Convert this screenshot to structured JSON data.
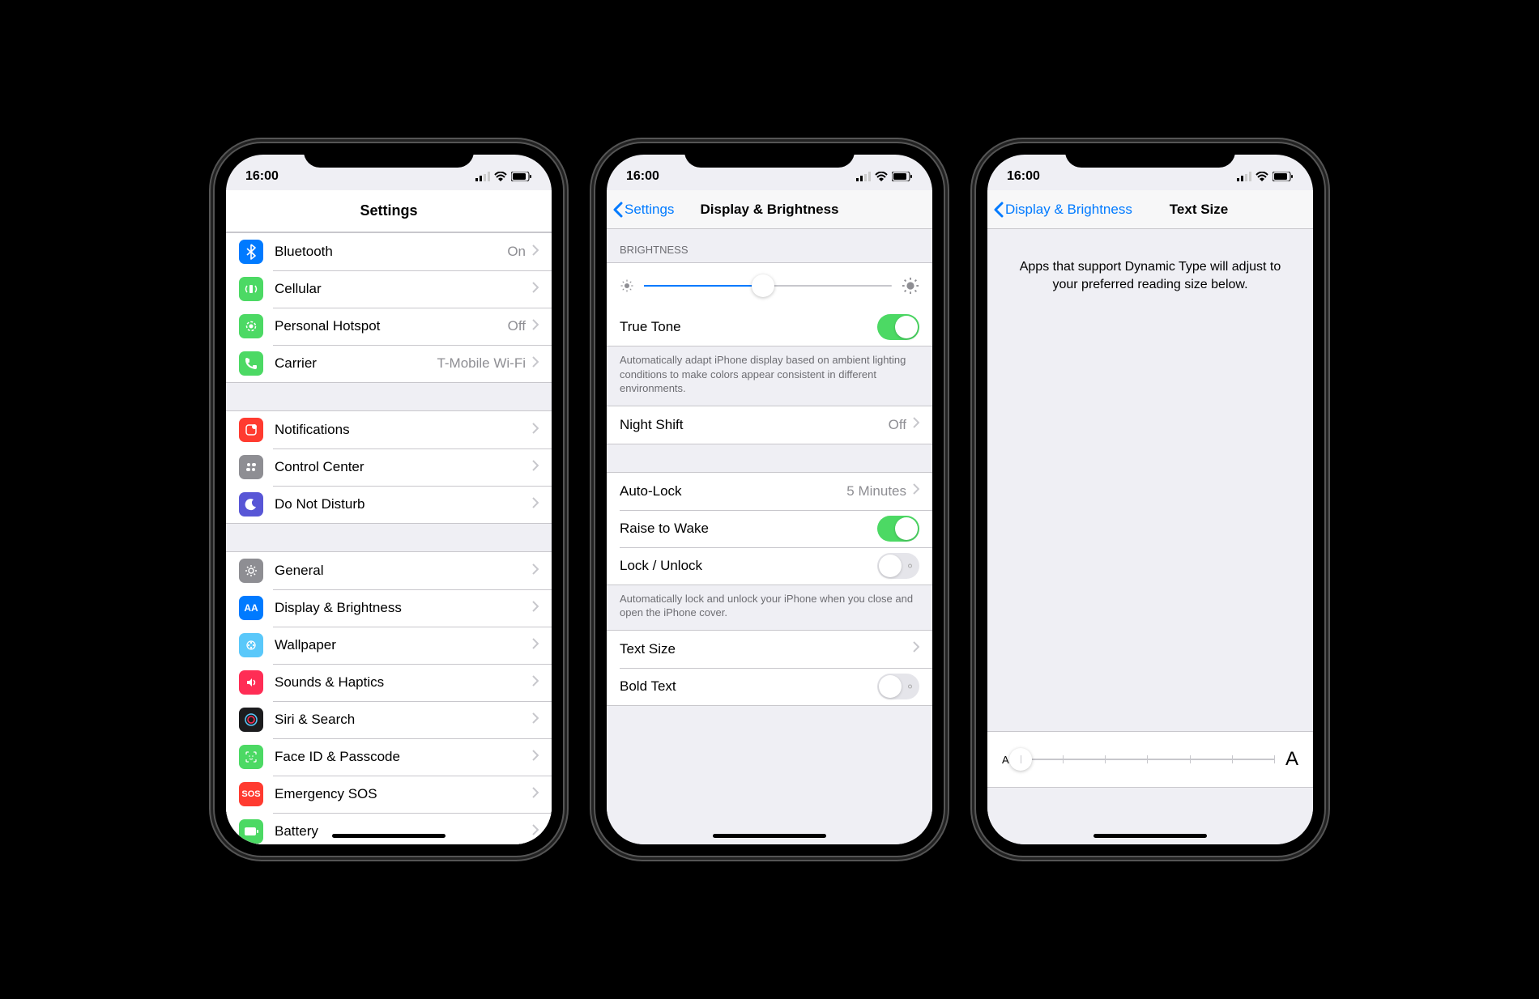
{
  "status": {
    "time": "16:00"
  },
  "screen1": {
    "title": "Settings",
    "groups": [
      {
        "rows": [
          {
            "icon": "bluetooth",
            "bg": "#007aff",
            "label": "Bluetooth",
            "value": "On",
            "chevron": true
          },
          {
            "icon": "cellular",
            "bg": "#4cd964",
            "label": "Cellular",
            "value": "",
            "chevron": true
          },
          {
            "icon": "hotspot",
            "bg": "#4cd964",
            "label": "Personal Hotspot",
            "value": "Off",
            "chevron": true
          },
          {
            "icon": "phone",
            "bg": "#4cd964",
            "label": "Carrier",
            "value": "T-Mobile Wi-Fi",
            "chevron": true
          }
        ]
      },
      {
        "rows": [
          {
            "icon": "notifications",
            "bg": "#ff3b30",
            "label": "Notifications",
            "value": "",
            "chevron": true
          },
          {
            "icon": "controlcenter",
            "bg": "#8e8e93",
            "label": "Control Center",
            "value": "",
            "chevron": true
          },
          {
            "icon": "dnd",
            "bg": "#5856d6",
            "label": "Do Not Disturb",
            "value": "",
            "chevron": true
          }
        ]
      },
      {
        "rows": [
          {
            "icon": "general",
            "bg": "#8e8e93",
            "label": "General",
            "value": "",
            "chevron": true
          },
          {
            "icon": "display",
            "bg": "#007aff",
            "label": "Display & Brightness",
            "value": "",
            "chevron": true
          },
          {
            "icon": "wallpaper",
            "bg": "#5ac8fa",
            "label": "Wallpaper",
            "value": "",
            "chevron": true
          },
          {
            "icon": "sounds",
            "bg": "#ff2d55",
            "label": "Sounds & Haptics",
            "value": "",
            "chevron": true
          },
          {
            "icon": "siri",
            "bg": "#1c1c1e",
            "label": "Siri & Search",
            "value": "",
            "chevron": true
          },
          {
            "icon": "faceid",
            "bg": "#4cd964",
            "label": "Face ID & Passcode",
            "value": "",
            "chevron": true
          },
          {
            "icon": "sos",
            "bg": "#ff3b30",
            "label": "Emergency SOS",
            "value": "",
            "chevron": true
          },
          {
            "icon": "battery",
            "bg": "#4cd964",
            "label": "Battery",
            "value": "",
            "chevron": true
          }
        ]
      }
    ]
  },
  "screen2": {
    "back": "Settings",
    "title": "Display & Brightness",
    "brightness_header": "BRIGHTNESS",
    "brightness_value_pct": 48,
    "truetone_label": "True Tone",
    "truetone_on": true,
    "truetone_footer": "Automatically adapt iPhone display based on ambient lighting conditions to make colors appear consistent in different environments.",
    "nightshift_label": "Night Shift",
    "nightshift_value": "Off",
    "autolock_label": "Auto-Lock",
    "autolock_value": "5 Minutes",
    "raise_label": "Raise to Wake",
    "raise_on": true,
    "lockunlock_label": "Lock / Unlock",
    "lockunlock_on": false,
    "lockunlock_footer": "Automatically lock and unlock your iPhone when you close and open the iPhone cover.",
    "textsize_label": "Text Size",
    "boldtext_label": "Bold Text",
    "boldtext_on": false
  },
  "screen3": {
    "back": "Display & Brightness",
    "title": "Text Size",
    "description": "Apps that support Dynamic Type will adjust to your preferred reading size below.",
    "small_a": "A",
    "large_a": "A",
    "steps": 7,
    "position": 0
  }
}
